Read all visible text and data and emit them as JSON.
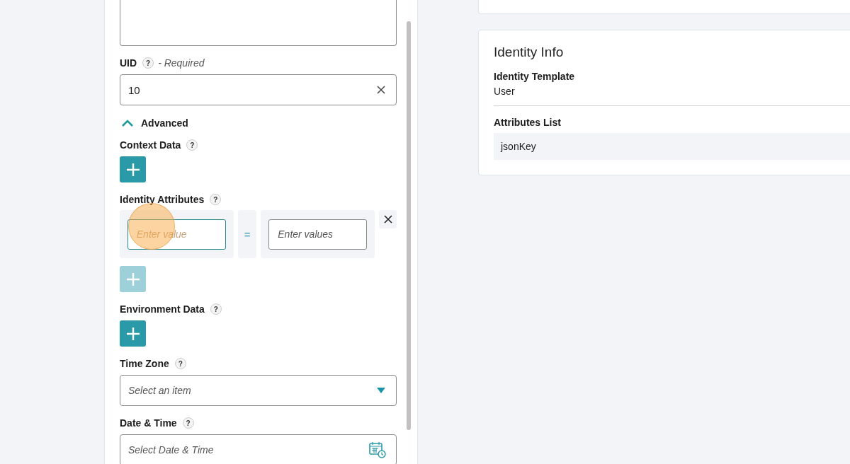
{
  "form": {
    "uid": {
      "label": "UID",
      "help": "?",
      "required_note": "- Required",
      "value": "10"
    },
    "advanced": {
      "label": "Advanced",
      "expanded": true
    },
    "context_data": {
      "label": "Context Data",
      "help": "?",
      "add_disabled": false
    },
    "identity_attributes": {
      "label": "Identity Attributes",
      "help": "?",
      "rows": [
        {
          "key_placeholder": "Enter value",
          "operator": "=",
          "value_placeholder": "Enter values",
          "focused": true
        }
      ],
      "add_disabled": true
    },
    "environment_data": {
      "label": "Environment Data",
      "help": "?",
      "add_disabled": false
    },
    "time_zone": {
      "label": "Time Zone",
      "help": "?",
      "placeholder": "Select an item"
    },
    "date_time": {
      "label": "Date & Time",
      "help": "?",
      "placeholder": "Select Date & Time"
    }
  },
  "identity_info": {
    "title": "Identity Info",
    "template_label": "Identity Template",
    "template_value": "User",
    "attributes_label": "Attributes List",
    "attributes": [
      "jsonKey"
    ]
  }
}
